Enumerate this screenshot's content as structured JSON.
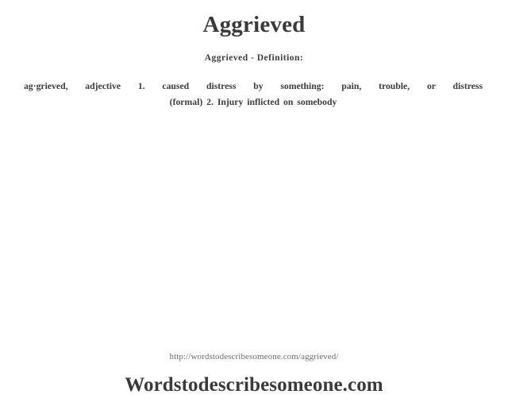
{
  "document": {
    "title": "Aggrieved",
    "subtitle": "Aggrieved - Definition:",
    "definition": {
      "line1": "ag·grieved,  adjective  1. caused  distress  by something:   pain,  trouble,  or  distress",
      "line2": "(formal) 2. Injury inflicted  on  somebody",
      "full_text": "ag·grieved, adjective 1. caused distress by something: pain, trouble, or distress (formal) 2. Injury inflicted on somebody",
      "headword": "ag·grieved",
      "part_of_speech": "adjective",
      "senses": [
        {
          "number": "1.",
          "text": "caused distress by something: pain, trouble, or distress (formal)"
        },
        {
          "number": "2.",
          "text": "Injury inflicted on somebody"
        }
      ]
    }
  },
  "footer": {
    "url": "http://wordstodescribesomeone.com/aggrieved/",
    "brand": "Wordstodescribesomeone.com"
  },
  "colors": {
    "background": "#ffffff",
    "title_text": "#3a3a3a",
    "body_text": "#3c3c3c",
    "url_text": "#6b6b6b"
  }
}
